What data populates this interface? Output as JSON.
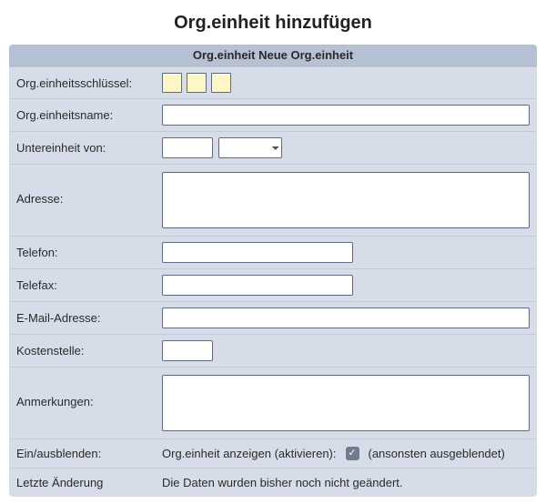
{
  "title": "Org.einheit hinzufügen",
  "panel_header": "Org.einheit Neue Org.einheit",
  "labels": {
    "key": "Org.einheitsschlüssel:",
    "name": "Org.einheitsname:",
    "subunit": "Untereinheit von:",
    "address": "Adresse:",
    "phone": "Telefon:",
    "fax": "Telefax:",
    "email": "E-Mail-Adresse:",
    "costcenter": "Kostenstelle:",
    "notes": "Anmerkungen:",
    "visibility": "Ein/ausblenden:",
    "lastchange": "Letzte Änderung"
  },
  "values": {
    "name": "",
    "sub1": "",
    "sub2": "",
    "address": "",
    "phone": "",
    "fax": "",
    "email": "",
    "costcenter": "",
    "notes": ""
  },
  "visibility": {
    "prefix": "Org.einheit anzeigen (aktivieren):",
    "suffix": "(ansonsten ausgeblendet)",
    "checked": true
  },
  "lastchange_text": "Die Daten wurden bisher noch nicht geändert."
}
